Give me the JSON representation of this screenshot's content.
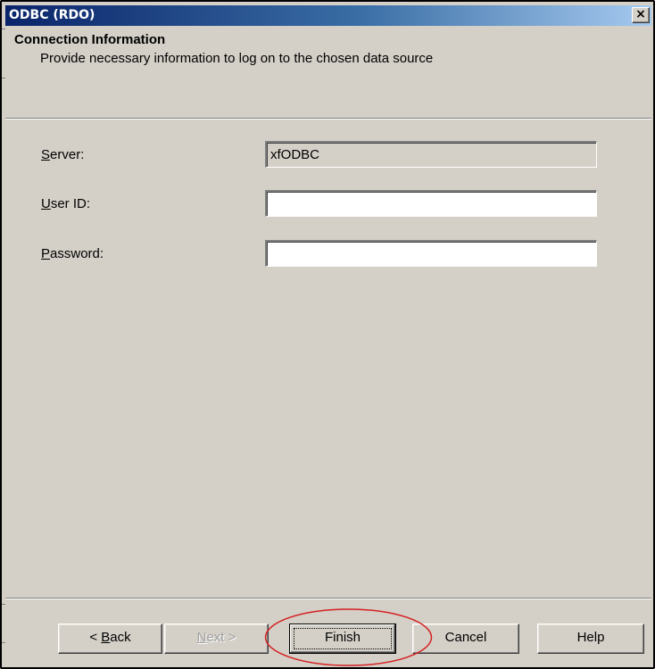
{
  "window": {
    "title": "ODBC (RDO)",
    "close_glyph": "×"
  },
  "header": {
    "title": "Connection Information",
    "description": "Provide necessary information to log on to the chosen data source"
  },
  "form": {
    "server": {
      "label_access": "S",
      "label_rest": "erver:",
      "value": "xfODBC",
      "readonly": true
    },
    "user_id": {
      "label_access": "U",
      "label_rest": "ser ID:",
      "value": ""
    },
    "password": {
      "label_access": "P",
      "label_rest": "assword:",
      "value": ""
    }
  },
  "buttons": {
    "back": {
      "prefix": "< ",
      "access": "B",
      "rest": "ack",
      "enabled": true
    },
    "next": {
      "access": "N",
      "rest": "ext >",
      "enabled": false
    },
    "finish": {
      "label": "Finish",
      "enabled": true,
      "default": true
    },
    "cancel": {
      "label": "Cancel",
      "enabled": true
    },
    "help": {
      "label": "Help",
      "enabled": true
    }
  },
  "annotation": {
    "highlight_color": "#d42020",
    "highlighted": "finish"
  },
  "colors": {
    "face": "#d4d0c8",
    "titlebar_start": "#0a246a",
    "titlebar_end": "#a6caf0"
  }
}
